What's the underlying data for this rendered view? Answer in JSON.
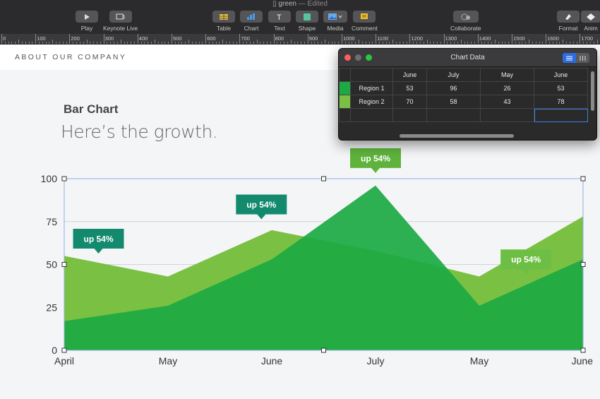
{
  "window": {
    "title": "green",
    "subtitle": "— Edited"
  },
  "toolbar": {
    "play": "Play",
    "keynote_live": "Keynote Live",
    "table": "Table",
    "chart": "Chart",
    "text": "Text",
    "shape": "Shape",
    "media": "Media",
    "comment": "Comment",
    "collaborate": "Collaborate",
    "format": "Format",
    "animate": "Anim"
  },
  "ruler": {
    "labels": [
      "0",
      "100",
      "200",
      "300",
      "400",
      "500",
      "600",
      "700",
      "800",
      "900",
      "1000",
      "1100",
      "1200",
      "1300",
      "1400",
      "1500",
      "1600",
      "1700"
    ]
  },
  "slide": {
    "header": "ABOUT OUR COMPANY",
    "chart_heading": "Bar Chart",
    "chart_subtitle": "Here’s the growth."
  },
  "chart_data_window": {
    "title": "Chart Data",
    "columns": [
      "June",
      "July",
      "May",
      "June"
    ],
    "rows": [
      {
        "label": "Region 1",
        "values": [
          "53",
          "96",
          "26",
          "53"
        ],
        "color": "#1daa44"
      },
      {
        "label": "Region 2",
        "values": [
          "70",
          "58",
          "43",
          "78"
        ],
        "color": "#7ac143"
      }
    ]
  },
  "chart_data": {
    "type": "area",
    "categories": [
      "April",
      "May",
      "June",
      "July",
      "May",
      "June"
    ],
    "series": [
      {
        "name": "Region 2",
        "values": [
          55,
          43,
          70,
          58,
          43,
          78
        ],
        "color": "#7ac143"
      },
      {
        "name": "Region 1",
        "values": [
          17,
          26,
          53,
          96,
          26,
          53
        ],
        "color": "#1daa44"
      }
    ],
    "ylim": [
      0,
      100
    ],
    "yticks": [
      0,
      25,
      50,
      75,
      100
    ],
    "grid": true,
    "annotations": [
      {
        "text": "up 54%",
        "category_index": 0.33,
        "value": 65,
        "color": "#138a6e"
      },
      {
        "text": "up 54%",
        "category_index": 1.9,
        "value": 85,
        "color": "#138a6e"
      },
      {
        "text": "up 54%",
        "category_index": 3.0,
        "value": 112,
        "color": "#5fb33d"
      },
      {
        "text": "up 54%",
        "category_index": 4.45,
        "value": 53,
        "color": "#6cbf44"
      }
    ]
  }
}
